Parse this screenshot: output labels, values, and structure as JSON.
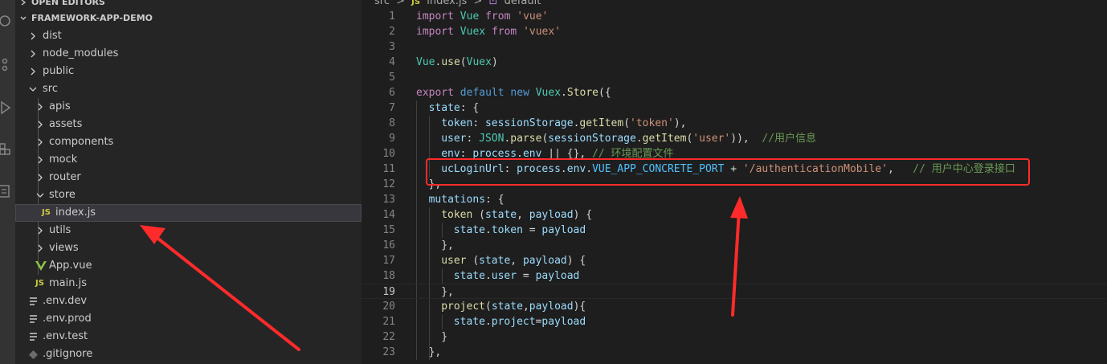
{
  "sidebar": {
    "open_editors_label": "OPEN EDITORS",
    "project_label": "FRAMEWORK-APP-DEMO",
    "items": [
      {
        "label": "dist",
        "type": "folder",
        "state": "collapsed"
      },
      {
        "label": "node_modules",
        "type": "folder",
        "state": "collapsed"
      },
      {
        "label": "public",
        "type": "folder",
        "state": "collapsed"
      },
      {
        "label": "src",
        "type": "folder",
        "state": "expanded"
      },
      {
        "label": "apis",
        "type": "folder",
        "state": "collapsed"
      },
      {
        "label": "assets",
        "type": "folder",
        "state": "collapsed"
      },
      {
        "label": "components",
        "type": "folder",
        "state": "collapsed"
      },
      {
        "label": "mock",
        "type": "folder",
        "state": "collapsed"
      },
      {
        "label": "router",
        "type": "folder",
        "state": "collapsed"
      },
      {
        "label": "store",
        "type": "folder",
        "state": "expanded"
      },
      {
        "label": "index.js",
        "type": "file",
        "icon": "JS",
        "selected": true
      },
      {
        "label": "utils",
        "type": "folder",
        "state": "collapsed"
      },
      {
        "label": "views",
        "type": "folder",
        "state": "collapsed"
      },
      {
        "label": "App.vue",
        "type": "file",
        "icon": "vue"
      },
      {
        "label": "main.js",
        "type": "file",
        "icon": "JS"
      },
      {
        "label": ".env.dev",
        "type": "file",
        "icon": "lines"
      },
      {
        "label": ".env.prod",
        "type": "file",
        "icon": "lines"
      },
      {
        "label": ".env.test",
        "type": "file",
        "icon": "lines"
      },
      {
        "label": ".gitignore",
        "type": "file",
        "icon": "diamond"
      }
    ]
  },
  "editor": {
    "breadcrumb": {
      "part1": "src",
      "sep": ">",
      "js_badge": "JS",
      "part2": "index.js",
      "part3": "default"
    },
    "current_line": 19,
    "lines": [
      {
        "n": "1",
        "code": "import Vue from 'vue'"
      },
      {
        "n": "2",
        "code": "import Vuex from 'vuex'"
      },
      {
        "n": "3",
        "code": ""
      },
      {
        "n": "4",
        "code": "Vue.use(Vuex)"
      },
      {
        "n": "5",
        "code": ""
      },
      {
        "n": "6",
        "code": "export default new Vuex.Store({"
      },
      {
        "n": "7",
        "code": "  state: {"
      },
      {
        "n": "8",
        "code": "    token: sessionStorage.getItem('token'),"
      },
      {
        "n": "9",
        "code": "    user: JSON.parse(sessionStorage.getItem('user')),  //用户信息"
      },
      {
        "n": "10",
        "code": "    env: process.env || {}, // 环境配置文件"
      },
      {
        "n": "11",
        "code": "    ucLoginUrl: process.env.VUE_APP_CONCRETE_PORT + '/authenticationMobile',   // 用户中心登录接口"
      },
      {
        "n": "12",
        "code": "  },"
      },
      {
        "n": "13",
        "code": "  mutations: {"
      },
      {
        "n": "14",
        "code": "    token (state, payload) {"
      },
      {
        "n": "15",
        "code": "      state.token = payload"
      },
      {
        "n": "16",
        "code": "    },"
      },
      {
        "n": "17",
        "code": "    user (state, payload) {"
      },
      {
        "n": "18",
        "code": "      state.user = payload"
      },
      {
        "n": "19",
        "code": "    },"
      },
      {
        "n": "20",
        "code": "    project(state,payload){"
      },
      {
        "n": "21",
        "code": "      state.project=payload"
      },
      {
        "n": "22",
        "code": "    }"
      },
      {
        "n": "23",
        "code": "  },"
      }
    ]
  },
  "colors": {
    "annotation_red": "#ff2b2b",
    "keyword": "#569cd6",
    "string": "#ce9178",
    "comment": "#6a9955"
  }
}
